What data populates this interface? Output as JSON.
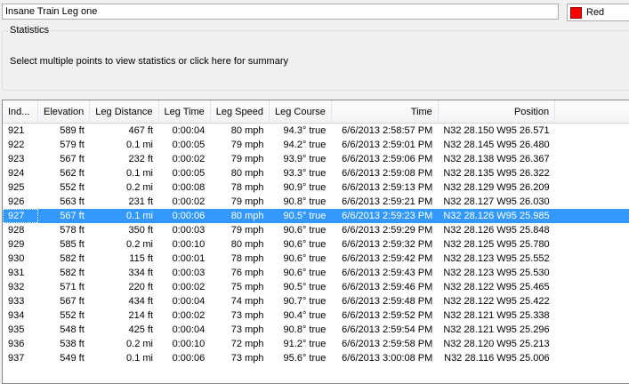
{
  "leg_name": "Insane Train Leg one",
  "color": {
    "label": "Red",
    "swatch": "#ff0000"
  },
  "statistics": {
    "title": "Statistics",
    "message": "Select multiple points to view statistics or click here for summary"
  },
  "columns": [
    "Ind...",
    "Elevation",
    "Leg Distance",
    "Leg Time",
    "Leg Speed",
    "Leg Course",
    "Time",
    "Position"
  ],
  "rows": [
    [
      "921",
      "589 ft",
      "467 ft",
      "0:00:04",
      "80 mph",
      "94.3° true",
      "6/6/2013 2:58:57 PM",
      "N32 28.150 W95 26.571"
    ],
    [
      "922",
      "579 ft",
      "0.1 mi",
      "0:00:05",
      "79 mph",
      "94.2° true",
      "6/6/2013 2:59:01 PM",
      "N32 28.145 W95 26.480"
    ],
    [
      "923",
      "567 ft",
      "232 ft",
      "0:00:02",
      "79 mph",
      "93.9° true",
      "6/6/2013 2:59:06 PM",
      "N32 28.138 W95 26.367"
    ],
    [
      "924",
      "562 ft",
      "0.1 mi",
      "0:00:05",
      "80 mph",
      "93.3° true",
      "6/6/2013 2:59:08 PM",
      "N32 28.135 W95 26.322"
    ],
    [
      "925",
      "552 ft",
      "0.2 mi",
      "0:00:08",
      "78 mph",
      "90.9° true",
      "6/6/2013 2:59:13 PM",
      "N32 28.129 W95 26.209"
    ],
    [
      "926",
      "563 ft",
      "231 ft",
      "0:00:02",
      "79 mph",
      "90.8° true",
      "6/6/2013 2:59:21 PM",
      "N32 28.127 W95 26.030"
    ],
    [
      "927",
      "567 ft",
      "0.1 mi",
      "0:00:06",
      "80 mph",
      "90.5° true",
      "6/6/2013 2:59:23 PM",
      "N32 28.126 W95 25.985"
    ],
    [
      "928",
      "578 ft",
      "350 ft",
      "0:00:03",
      "79 mph",
      "90.6° true",
      "6/6/2013 2:59:29 PM",
      "N32 28.126 W95 25.848"
    ],
    [
      "929",
      "585 ft",
      "0.2 mi",
      "0:00:10",
      "80 mph",
      "90.6° true",
      "6/6/2013 2:59:32 PM",
      "N32 28.125 W95 25.780"
    ],
    [
      "930",
      "582 ft",
      "115 ft",
      "0:00:01",
      "78 mph",
      "90.6° true",
      "6/6/2013 2:59:42 PM",
      "N32 28.123 W95 25.552"
    ],
    [
      "931",
      "582 ft",
      "334 ft",
      "0:00:03",
      "76 mph",
      "90.6° true",
      "6/6/2013 2:59:43 PM",
      "N32 28.123 W95 25.530"
    ],
    [
      "932",
      "571 ft",
      "220 ft",
      "0:00:02",
      "75 mph",
      "90.5° true",
      "6/6/2013 2:59:46 PM",
      "N32 28.122 W95 25.465"
    ],
    [
      "933",
      "567 ft",
      "434 ft",
      "0:00:04",
      "74 mph",
      "90.7° true",
      "6/6/2013 2:59:48 PM",
      "N32 28.122 W95 25.422"
    ],
    [
      "934",
      "552 ft",
      "214 ft",
      "0:00:02",
      "73 mph",
      "90.4° true",
      "6/6/2013 2:59:52 PM",
      "N32 28.121 W95 25.338"
    ],
    [
      "935",
      "548 ft",
      "425 ft",
      "0:00:04",
      "73 mph",
      "90.8° true",
      "6/6/2013 2:59:54 PM",
      "N32 28.121 W95 25.296"
    ],
    [
      "936",
      "538 ft",
      "0.2 mi",
      "0:00:10",
      "72 mph",
      "91.2° true",
      "6/6/2013 2:59:58 PM",
      "N32 28.120 W95 25.213"
    ],
    [
      "937",
      "549 ft",
      "0.1 mi",
      "0:00:06",
      "73 mph",
      "95.6° true",
      "6/6/2013 3:00:08 PM",
      "N32 28.116 W95 25.006"
    ]
  ],
  "selected_row": 6
}
